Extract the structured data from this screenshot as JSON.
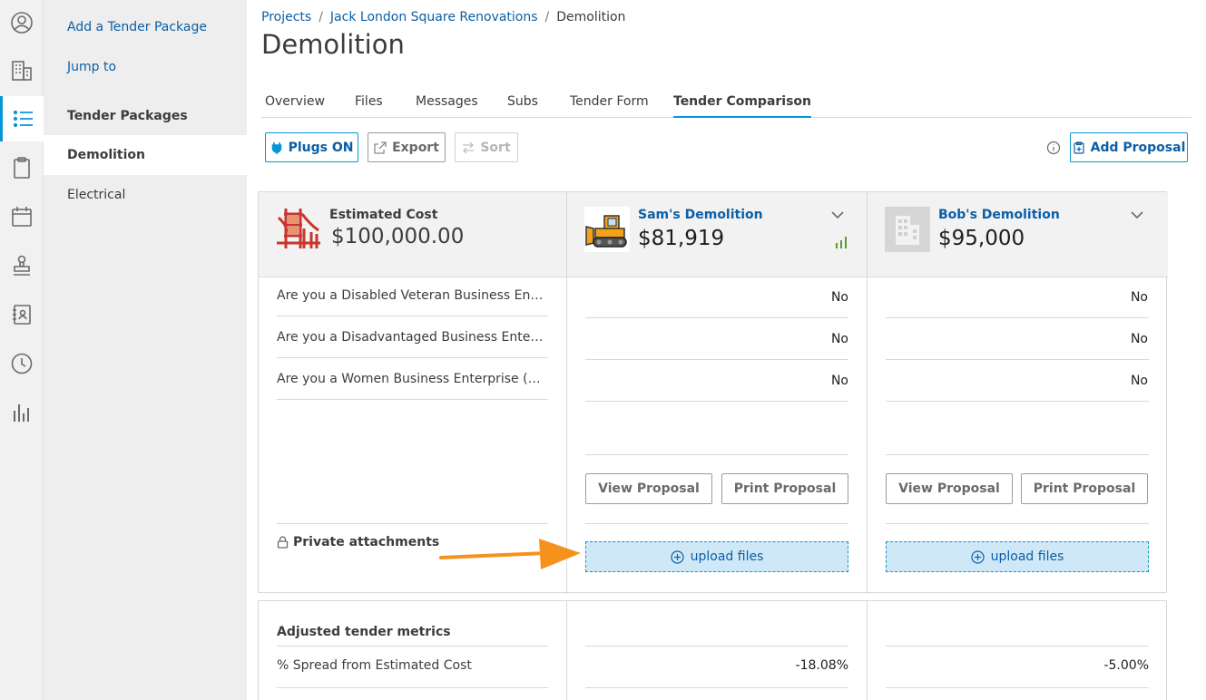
{
  "rail": {
    "icons": [
      "user-circle-icon",
      "building-icon",
      "list-icon",
      "clipboard-icon",
      "calendar-icon",
      "stamp-icon",
      "contacts-book-icon",
      "clock-icon",
      "bar-chart-icon"
    ],
    "active_index": 2,
    "accent_color": "#0696d7"
  },
  "sidebar": {
    "add_package": "Add a Tender Package",
    "jump_to": "Jump to",
    "section_title": "Tender Packages",
    "items": [
      {
        "label": "Demolition",
        "active": true
      },
      {
        "label": "Electrical",
        "active": false
      }
    ]
  },
  "breadcrumb": {
    "projects": "Projects",
    "project": "Jack London Square Renovations",
    "current": "Demolition",
    "separator": "/"
  },
  "page_title": "Demolition",
  "tabs": [
    {
      "label": "Overview"
    },
    {
      "label": "Files"
    },
    {
      "label": "Messages"
    },
    {
      "label": "Subs"
    },
    {
      "label": "Tender Form"
    },
    {
      "label": "Tender Comparison",
      "active": true
    }
  ],
  "toolbar": {
    "plugs": "Plugs ON",
    "export": "Export",
    "sort": "Sort",
    "add_proposal": "Add Proposal"
  },
  "comparison": {
    "estimate": {
      "label": "Estimated Cost",
      "value": "$100,000.00"
    },
    "bidders": [
      {
        "name": "Sam's Demolition",
        "amount": "$81,919",
        "answers": [
          "No",
          "No",
          "No"
        ],
        "icon": "bulldozer-icon"
      },
      {
        "name": "Bob's Demolition",
        "amount": "$95,000",
        "answers": [
          "No",
          "No",
          "No"
        ],
        "icon": "building-placeholder-icon"
      }
    ],
    "questions": [
      "Are you a Disabled Veteran Business Enterprise (DVBE)?",
      "Are you a Disadvantaged Business Enterprise (DBE)?",
      "Are you a Women Business Enterprise (WBE)?"
    ],
    "view_proposal": "View Proposal",
    "print_proposal": "Print Proposal",
    "private_attachments": "Private attachments",
    "upload_files": "upload files"
  },
  "metrics": {
    "title": "Adjusted tender metrics",
    "spread_label": "% Spread from Estimated Cost",
    "values": [
      "-18.08%",
      "-5.00%"
    ]
  },
  "colors": {
    "link": "#0a5fa6",
    "accent": "#0696d7",
    "upload_bg": "#cfe8f7",
    "annotation_arrow": "#f5921e",
    "signal_green": "#5a9a2a"
  }
}
